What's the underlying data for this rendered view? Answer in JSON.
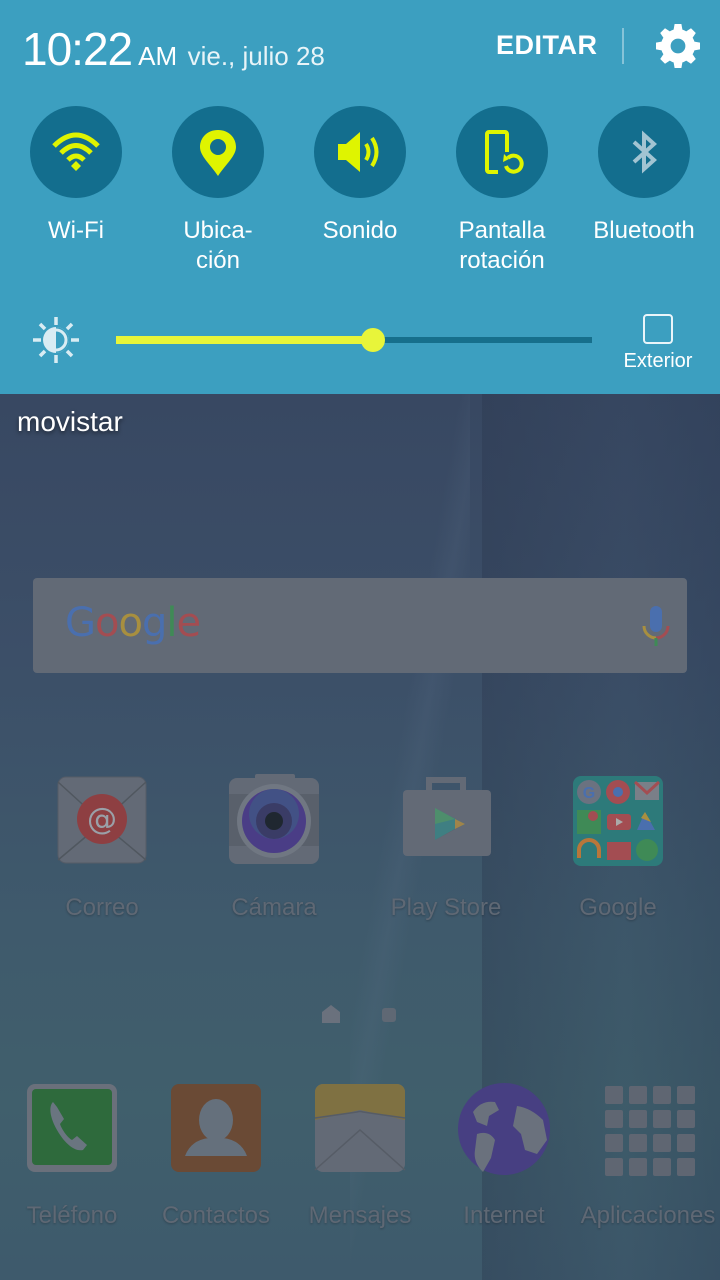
{
  "status": {
    "time": "10:22",
    "ampm": "AM",
    "date": "vie., julio 28",
    "edit_label": "EDITAR",
    "settings_icon": "gear-icon"
  },
  "quick_toggles": [
    {
      "label": "Wi-Fi",
      "icon": "wifi-icon",
      "state": "on"
    },
    {
      "label": "Ubica-\nción",
      "icon": "location-pin-icon",
      "state": "on"
    },
    {
      "label": "Sonido",
      "icon": "speaker-icon",
      "state": "on"
    },
    {
      "label": "Pantalla\nrotación",
      "icon": "screen-rotation-icon",
      "state": "on"
    },
    {
      "label": "Bluetooth",
      "icon": "bluetooth-icon",
      "state": "off"
    }
  ],
  "brightness": {
    "level": 0.54,
    "icon": "brightness-icon",
    "outdoor_label": "Exterior",
    "outdoor_checked": false
  },
  "home": {
    "carrier": "movistar",
    "search": {
      "logo_letters": [
        {
          "ch": "G",
          "color": "#4a6fae"
        },
        {
          "ch": "o",
          "color": "#a34d52"
        },
        {
          "ch": "o",
          "color": "#a88f3f"
        },
        {
          "ch": "g",
          "color": "#4a6fae"
        },
        {
          "ch": "l",
          "color": "#3f8a56"
        },
        {
          "ch": "e",
          "color": "#a34d52"
        }
      ],
      "mic_icon": "microphone-icon"
    },
    "apps": [
      {
        "label": "Correo",
        "icon": "email-icon"
      },
      {
        "label": "Cámara",
        "icon": "camera-icon"
      },
      {
        "label": "Play Store",
        "icon": "play-store-icon"
      },
      {
        "label": "Google",
        "icon": "google-folder-icon"
      }
    ],
    "page_indicator": {
      "pages": 2,
      "current": "home"
    },
    "dock": [
      {
        "label": "Teléfono",
        "icon": "phone-icon"
      },
      {
        "label": "Contactos",
        "icon": "contacts-icon"
      },
      {
        "label": "Mensajes",
        "icon": "messages-icon"
      },
      {
        "label": "Internet",
        "icon": "globe-icon"
      },
      {
        "label": "Aplicaciones",
        "icon": "apps-grid-icon"
      }
    ]
  },
  "colors": {
    "panel_bg": "#3c9fc0",
    "toggle_circle": "#136e8e",
    "accent_on": "#dff400",
    "accent_off": "#a2c4d2"
  }
}
